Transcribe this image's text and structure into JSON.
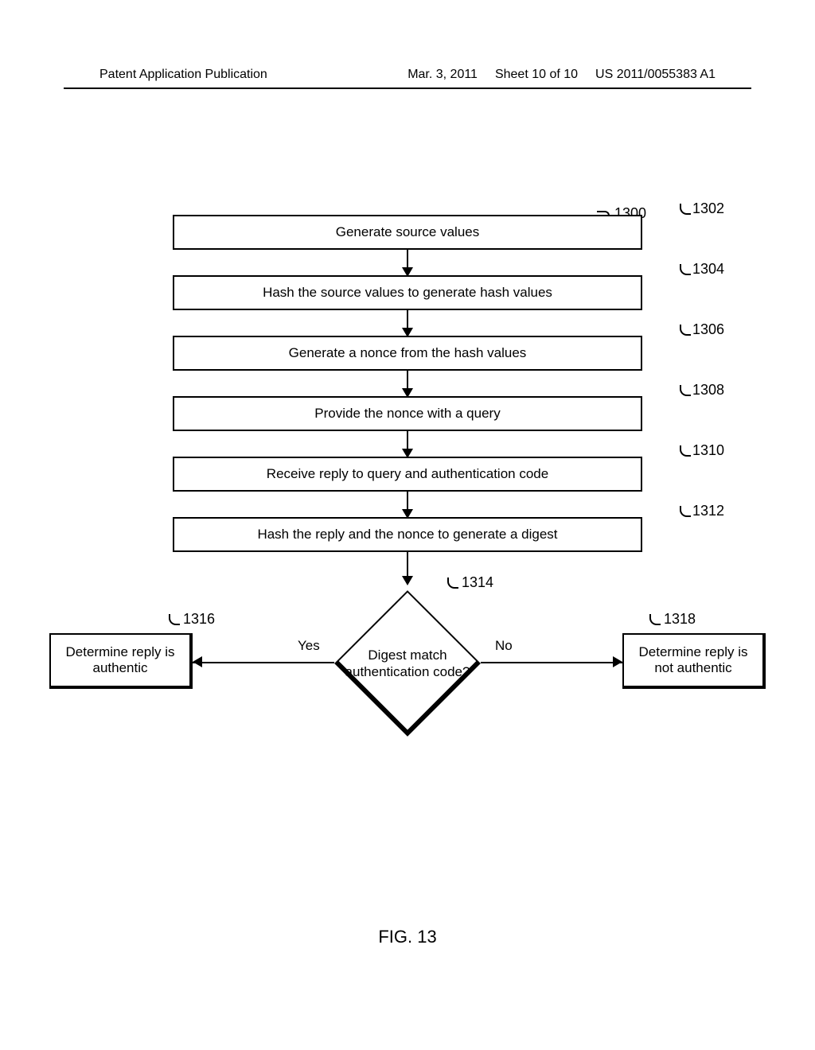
{
  "header": {
    "left": "Patent Application Publication",
    "date": "Mar. 3, 2011",
    "sheet": "Sheet 10 of 10",
    "docnum": "US 2011/0055383 A1"
  },
  "chart_data": {
    "type": "flowchart",
    "overall_ref": "1300",
    "steps": [
      {
        "ref": "1302",
        "text": "Generate source values"
      },
      {
        "ref": "1304",
        "text": "Hash the source values to generate hash values"
      },
      {
        "ref": "1306",
        "text": "Generate a nonce from the hash values"
      },
      {
        "ref": "1308",
        "text": "Provide the nonce with a query"
      },
      {
        "ref": "1310",
        "text": "Receive reply to query and authentication code"
      },
      {
        "ref": "1312",
        "text": "Hash the reply and the nonce to generate a digest"
      }
    ],
    "decision": {
      "ref": "1314",
      "text": "Digest match authentication code?",
      "yes_label": "Yes",
      "no_label": "No",
      "yes_outcome": {
        "ref": "1316",
        "text": "Determine reply is authentic"
      },
      "no_outcome": {
        "ref": "1318",
        "text": "Determine reply is not authentic"
      }
    },
    "figure_label": "FIG. 13"
  }
}
